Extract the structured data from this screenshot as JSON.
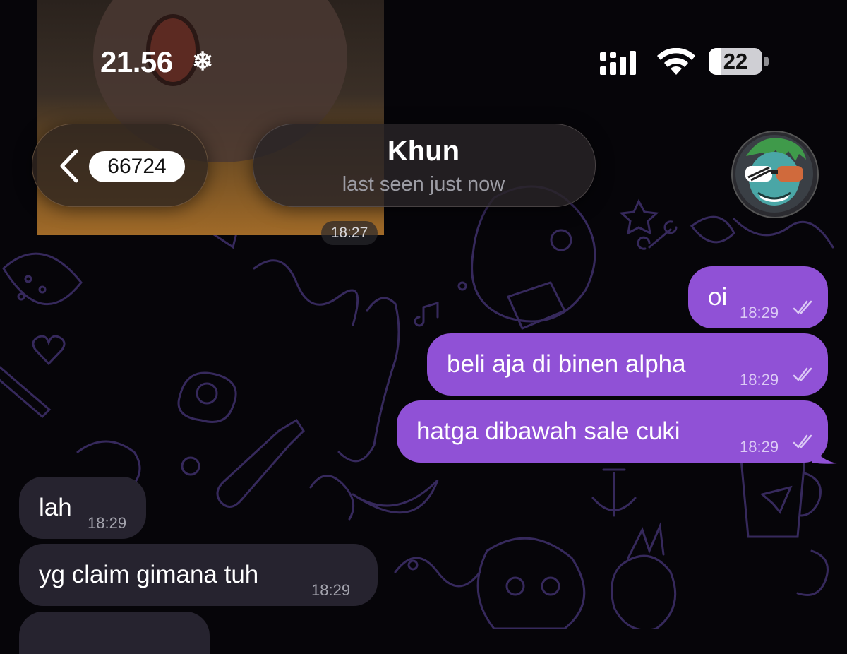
{
  "status_bar": {
    "time": "21.56",
    "extra_icon": "snowflake-icon",
    "battery_percent": "22",
    "battery_level": 0.22
  },
  "header": {
    "back_badge": "66724",
    "chat_name": "Khun",
    "chat_status": "last seen just now"
  },
  "previous_media": {
    "time": "18:27"
  },
  "messages": [
    {
      "dir": "out",
      "text": "oi",
      "time": "18:29",
      "status": "read"
    },
    {
      "dir": "out",
      "text": "beli aja di binen alpha",
      "time": "18:29",
      "status": "read"
    },
    {
      "dir": "out",
      "text": "hatga dibawah sale cuki",
      "time": "18:29",
      "status": "read"
    },
    {
      "dir": "in",
      "text": "lah",
      "time": "18:29"
    },
    {
      "dir": "in",
      "text": "yg claim gimana tuh",
      "time": "18:29"
    }
  ],
  "colors": {
    "outgoing_bubble": "#9051d6",
    "incoming_bubble": "#26232f",
    "background": "#060509",
    "pattern": "#3a2c63"
  }
}
